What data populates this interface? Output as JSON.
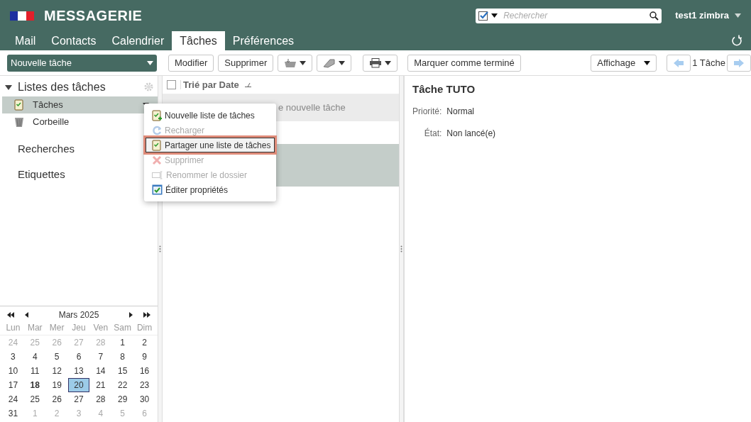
{
  "header": {
    "title": "MESSAGERIE",
    "search": {
      "placeholder": "Rechercher"
    },
    "user": "test1 zimbra"
  },
  "tabs": [
    {
      "label": "Mail",
      "selected": false
    },
    {
      "label": "Contacts",
      "selected": false
    },
    {
      "label": "Calendrier",
      "selected": false
    },
    {
      "label": "Tâches",
      "selected": true
    },
    {
      "label": "Préférences",
      "selected": false
    }
  ],
  "toolbar": {
    "new_button": "Nouvelle tâche",
    "buttons": [
      "Modifier",
      "Supprimer"
    ],
    "mark_button": "Marquer comme terminé",
    "view_button": "Affichage",
    "count": "1 Tâche"
  },
  "sidebar": {
    "heading": "Listes des tâches",
    "expanded": true,
    "items": [
      {
        "label": "Tâches",
        "kind": "tasks",
        "selected": true
      },
      {
        "label": "Corbeille",
        "kind": "trash",
        "selected": false
      }
    ],
    "sections": [
      "Recherches",
      "Etiquettes"
    ]
  },
  "context_menu": {
    "items": [
      {
        "label": "Nouvelle liste de tâches",
        "kind": "new",
        "disabled": false,
        "selected": false
      },
      {
        "label": "Recharger",
        "kind": "reload",
        "disabled": true,
        "selected": false
      },
      {
        "label": "Partager une liste de tâches",
        "kind": "share",
        "disabled": false,
        "selected": true
      },
      {
        "label": "Supprimer",
        "kind": "delete",
        "disabled": true,
        "selected": false
      },
      {
        "label": "Renommer le dossier",
        "kind": "rename",
        "disabled": true,
        "selected": false
      },
      {
        "label": "Éditer propriétés",
        "kind": "edit",
        "disabled": false,
        "selected": false
      }
    ]
  },
  "task_list": {
    "sort_label": "Trié par Date",
    "checked": false,
    "add_hint": "e nouvelle tâche",
    "rows": [
      {
        "selected": true
      }
    ]
  },
  "reading_pane": {
    "title": "Tâche TUTO",
    "fields": [
      {
        "label": "Priorité:",
        "value": "Normal"
      },
      {
        "label": "État:",
        "value": "Non lancé(e)"
      }
    ]
  },
  "calendar": {
    "month": "Mars 2025",
    "weekdays": [
      "Lun",
      "Mar",
      "Mer",
      "Jeu",
      "Ven",
      "Sam",
      "Dim"
    ],
    "weeks": [
      [
        {
          "d": "24",
          "muted": true,
          "today": false,
          "selected": false
        },
        {
          "d": "25",
          "muted": true,
          "today": false,
          "selected": false
        },
        {
          "d": "26",
          "muted": true,
          "today": false,
          "selected": false
        },
        {
          "d": "27",
          "muted": true,
          "today": false,
          "selected": false
        },
        {
          "d": "28",
          "muted": true,
          "today": false,
          "selected": false
        },
        {
          "d": "1",
          "muted": false,
          "today": false,
          "selected": false
        },
        {
          "d": "2",
          "muted": false,
          "today": false,
          "selected": false
        }
      ],
      [
        {
          "d": "3",
          "muted": false,
          "today": false,
          "selected": false
        },
        {
          "d": "4",
          "muted": false,
          "today": false,
          "selected": false
        },
        {
          "d": "5",
          "muted": false,
          "today": false,
          "selected": false
        },
        {
          "d": "6",
          "muted": false,
          "today": false,
          "selected": false
        },
        {
          "d": "7",
          "muted": false,
          "today": false,
          "selected": false
        },
        {
          "d": "8",
          "muted": false,
          "today": false,
          "selected": false
        },
        {
          "d": "9",
          "muted": false,
          "today": false,
          "selected": false
        }
      ],
      [
        {
          "d": "10",
          "muted": false,
          "today": false,
          "selected": false
        },
        {
          "d": "11",
          "muted": false,
          "today": false,
          "selected": false
        },
        {
          "d": "12",
          "muted": false,
          "today": false,
          "selected": false
        },
        {
          "d": "13",
          "muted": false,
          "today": false,
          "selected": false
        },
        {
          "d": "14",
          "muted": false,
          "today": false,
          "selected": false
        },
        {
          "d": "15",
          "muted": false,
          "today": false,
          "selected": false
        },
        {
          "d": "16",
          "muted": false,
          "today": false,
          "selected": false
        }
      ],
      [
        {
          "d": "17",
          "muted": false,
          "today": false,
          "selected": false
        },
        {
          "d": "18",
          "muted": false,
          "today": true,
          "selected": false
        },
        {
          "d": "19",
          "muted": false,
          "today": false,
          "selected": false
        },
        {
          "d": "20",
          "muted": false,
          "today": false,
          "selected": true
        },
        {
          "d": "21",
          "muted": false,
          "today": false,
          "selected": false
        },
        {
          "d": "22",
          "muted": false,
          "today": false,
          "selected": false
        },
        {
          "d": "23",
          "muted": false,
          "today": false,
          "selected": false
        }
      ],
      [
        {
          "d": "24",
          "muted": false,
          "today": false,
          "selected": false
        },
        {
          "d": "25",
          "muted": false,
          "today": false,
          "selected": false
        },
        {
          "d": "26",
          "muted": false,
          "today": false,
          "selected": false
        },
        {
          "d": "27",
          "muted": false,
          "today": false,
          "selected": false
        },
        {
          "d": "28",
          "muted": false,
          "today": false,
          "selected": false
        },
        {
          "d": "29",
          "muted": false,
          "today": false,
          "selected": false
        },
        {
          "d": "30",
          "muted": false,
          "today": false,
          "selected": false
        }
      ],
      [
        {
          "d": "31",
          "muted": false,
          "today": false,
          "selected": false
        },
        {
          "d": "1",
          "muted": true,
          "today": false,
          "selected": false
        },
        {
          "d": "2",
          "muted": true,
          "today": false,
          "selected": false
        },
        {
          "d": "3",
          "muted": true,
          "today": false,
          "selected": false
        },
        {
          "d": "4",
          "muted": true,
          "today": false,
          "selected": false
        },
        {
          "d": "5",
          "muted": true,
          "today": false,
          "selected": false
        },
        {
          "d": "6",
          "muted": true,
          "today": false,
          "selected": false
        }
      ]
    ]
  }
}
